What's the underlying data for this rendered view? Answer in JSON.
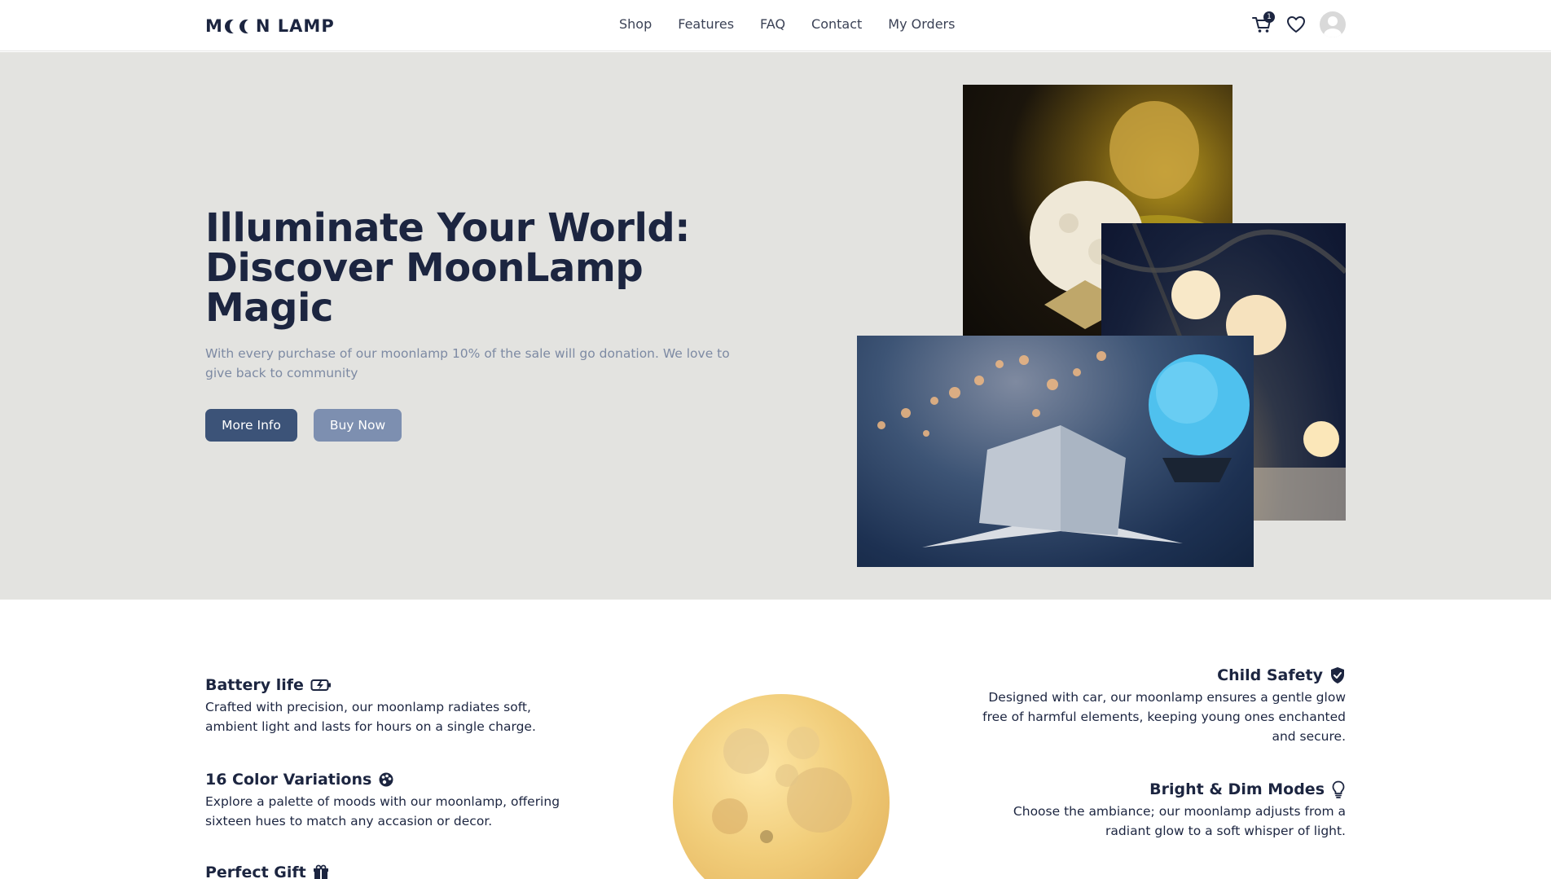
{
  "header": {
    "logo_start": "M",
    "logo_end": "N LAMP",
    "nav": [
      "Shop",
      "Features",
      "FAQ",
      "Contact",
      "My Orders"
    ],
    "cart_count": "1",
    "icons": [
      "cart-icon",
      "heart-icon",
      "user-avatar-icon"
    ]
  },
  "hero": {
    "title": "Illuminate Your World: Discover MoonLamp Magic",
    "subtitle": "With every purchase of our moonlamp 10% of the sale will go donation. We love to give back to community",
    "more_info": "More Info",
    "buy_now": "Buy Now"
  },
  "features": {
    "battery": {
      "title": "Battery life",
      "text": "Crafted with precision, our moonlamp radiates soft, ambient light and lasts for hours on a single charge.",
      "icon": "battery-charge-icon"
    },
    "colors": {
      "title": "16 Color Variations",
      "text": "Explore a palette of moods with our moonlamp, offering sixteen hues to match any accasion or decor.",
      "icon": "palette-icon"
    },
    "gift": {
      "title": "Perfect Gift",
      "icon": "gift-icon"
    },
    "safety": {
      "title": "Child Safety",
      "text": "Designed with car, our moonlamp ensures a gentle glow free of harmful elements, keeping young ones enchanted and secure.",
      "icon": "shield-check-icon"
    },
    "modes": {
      "title": "Bright & Dim Modes",
      "text": "Choose the ambiance; our moonlamp adjusts from a radiant glow to a soft whisper of light.",
      "icon": "lightbulb-icon"
    }
  },
  "colors": {
    "navy": "#1c2540",
    "hero_bg": "#e3e3e0",
    "primary_button": "#3c5378",
    "secondary_button": "#7d8fb0",
    "muted_text": "#7d8aa3"
  }
}
